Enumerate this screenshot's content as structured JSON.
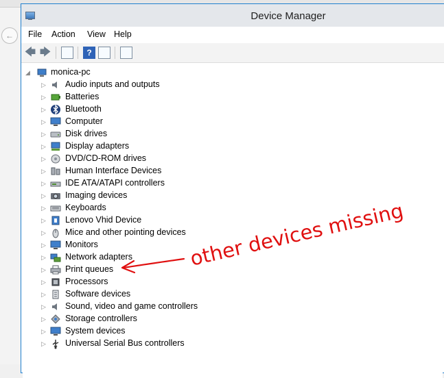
{
  "window": {
    "title": "Device Manager"
  },
  "menu": [
    "File",
    "Action",
    "View",
    "Help"
  ],
  "toolbar": {
    "back_icon": "back-arrow-icon",
    "forward_icon": "forward-arrow-icon",
    "help_glyph": "?"
  },
  "tree": {
    "root": {
      "label": "monica-pc",
      "icon": "computer-icon"
    },
    "items": [
      {
        "label": "Audio inputs and outputs",
        "icon": "speaker-icon"
      },
      {
        "label": "Batteries",
        "icon": "battery-icon"
      },
      {
        "label": "Bluetooth",
        "icon": "bluetooth-icon"
      },
      {
        "label": "Computer",
        "icon": "monitor-icon"
      },
      {
        "label": "Disk drives",
        "icon": "disk-drive-icon"
      },
      {
        "label": "Display adapters",
        "icon": "display-adapter-icon"
      },
      {
        "label": "DVD/CD-ROM drives",
        "icon": "dvd-icon"
      },
      {
        "label": "Human Interface Devices",
        "icon": "hid-icon"
      },
      {
        "label": "IDE ATA/ATAPI controllers",
        "icon": "ide-controller-icon"
      },
      {
        "label": "Imaging devices",
        "icon": "camera-icon"
      },
      {
        "label": "Keyboards",
        "icon": "keyboard-icon"
      },
      {
        "label": "Lenovo Vhid Device",
        "icon": "usb-device-icon"
      },
      {
        "label": "Mice and other pointing devices",
        "icon": "mouse-icon"
      },
      {
        "label": "Monitors",
        "icon": "monitor-icon"
      },
      {
        "label": "Network adapters",
        "icon": "network-icon"
      },
      {
        "label": "Print queues",
        "icon": "printer-icon"
      },
      {
        "label": "Processors",
        "icon": "cpu-icon"
      },
      {
        "label": "Software devices",
        "icon": "software-icon"
      },
      {
        "label": "Sound, video and game controllers",
        "icon": "speaker-icon"
      },
      {
        "label": "Storage controllers",
        "icon": "storage-icon"
      },
      {
        "label": "System devices",
        "icon": "monitor-icon"
      },
      {
        "label": "Universal Serial Bus controllers",
        "icon": "usb-icon"
      }
    ]
  },
  "annotation": {
    "text": "other devices missing",
    "color": "#e01010"
  }
}
